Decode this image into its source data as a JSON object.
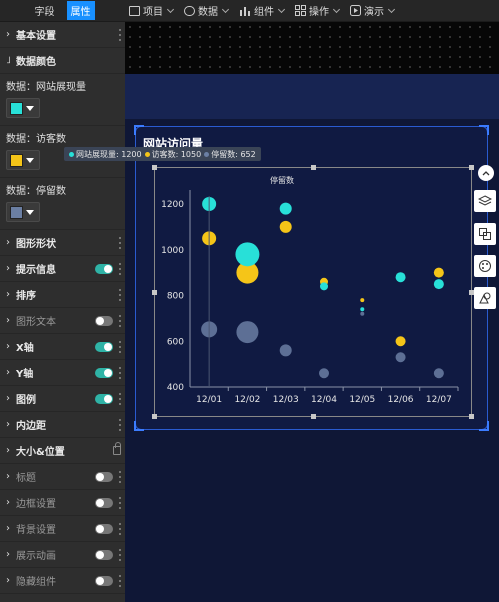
{
  "panel": {
    "tabs": [
      "字段",
      "属性"
    ],
    "sections": [
      {
        "label": "基本设置",
        "state": "collapsed"
      },
      {
        "label": "数据颜色",
        "state": "expanded"
      }
    ],
    "data_colors": [
      {
        "label": "数据：网站展现量",
        "color": "#28e0d8"
      },
      {
        "label": "数据：访客数",
        "color": "#f5c518"
      },
      {
        "label": "数据：停留数",
        "color": "#6b7fa3"
      }
    ],
    "items": [
      {
        "label": "图形形状",
        "toggle": null,
        "bold": true
      },
      {
        "label": "提示信息",
        "toggle": "on",
        "bold": true
      },
      {
        "label": "排序",
        "toggle": null,
        "bold": true
      },
      {
        "label": "图形文本",
        "toggle": "off",
        "bold": false
      },
      {
        "label": "X轴",
        "toggle": "on",
        "bold": true
      },
      {
        "label": "Y轴",
        "toggle": "on",
        "bold": true
      },
      {
        "label": "图例",
        "toggle": "on",
        "bold": true
      },
      {
        "label": "内边距",
        "toggle": null,
        "bold": true
      },
      {
        "label": "大小&位置",
        "toggle": null,
        "bold": true,
        "locked": true
      },
      {
        "label": "标题",
        "toggle": "off",
        "bold": false
      },
      {
        "label": "边框设置",
        "toggle": "off",
        "bold": false
      },
      {
        "label": "背景设置",
        "toggle": "off",
        "bold": false
      },
      {
        "label": "展示动画",
        "toggle": "off",
        "bold": false
      },
      {
        "label": "隐藏组件",
        "toggle": "off",
        "bold": false
      }
    ]
  },
  "toolbar": {
    "items": [
      {
        "label": "项目",
        "icon": "window-icon"
      },
      {
        "label": "数据",
        "icon": "database-icon"
      },
      {
        "label": "组件",
        "icon": "bar-chart-icon"
      },
      {
        "label": "操作",
        "icon": "grid-icon"
      },
      {
        "label": "演示",
        "icon": "play-icon"
      }
    ]
  },
  "widget": {
    "title": "网站访问量",
    "tooltip": {
      "items": [
        {
          "label": "网站展现量: 1200",
          "color": "#28e0d8"
        },
        {
          "label": "访客数: 1050",
          "color": "#f5c518"
        },
        {
          "label": "停留数: 652",
          "color": "#6b7fa3"
        }
      ]
    },
    "legend_tail": "停留数",
    "side_icons": [
      "up-icon",
      "layers-icon",
      "resize-icon",
      "palette-icon",
      "shapes-icon"
    ]
  },
  "chart_data": {
    "type": "scatter",
    "categories": [
      "12/01",
      "12/02",
      "12/03",
      "12/04",
      "12/05",
      "12/06",
      "12/07"
    ],
    "ylim": [
      400,
      1300
    ],
    "yticks": [
      400,
      600,
      800,
      1000,
      1200
    ],
    "grid": false,
    "series": [
      {
        "name": "网站展现量",
        "color": "#28e0d8",
        "values": [
          1200,
          980,
          1180,
          840,
          740,
          880,
          850
        ],
        "sizes": [
          7,
          12,
          6,
          4,
          2,
          5,
          5
        ]
      },
      {
        "name": "访客数",
        "color": "#f5c518",
        "values": [
          1050,
          900,
          1100,
          860,
          780,
          600,
          900
        ],
        "sizes": [
          7,
          11,
          6,
          4,
          2,
          5,
          5
        ]
      },
      {
        "name": "停留数",
        "color": "#6b7fa3",
        "values": [
          652,
          640,
          560,
          460,
          720,
          530,
          460
        ],
        "sizes": [
          8,
          11,
          6,
          5,
          2,
          5,
          5
        ]
      }
    ]
  }
}
